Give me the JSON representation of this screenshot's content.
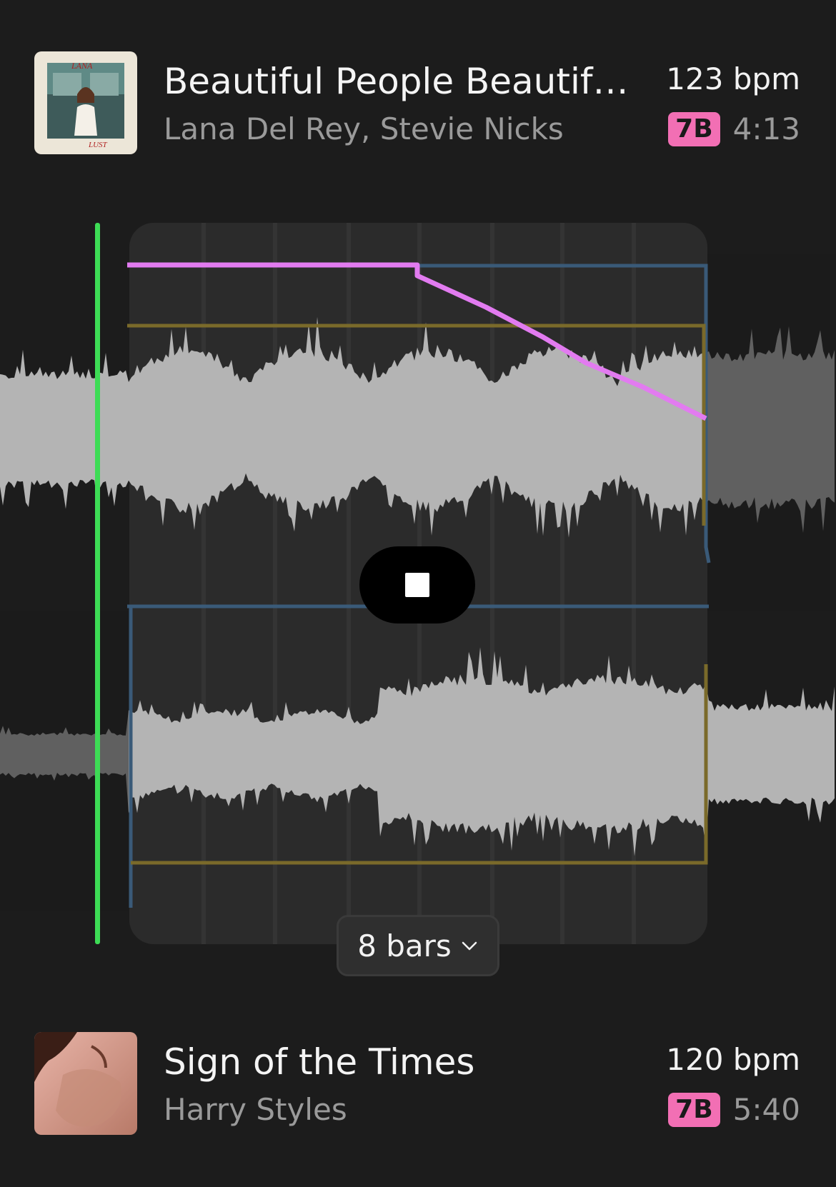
{
  "current_track": {
    "title": "Beautiful People Beautiful...",
    "artist": "Lana Del Rey, Stevie Nicks",
    "bpm": "123 bpm",
    "key": "7B",
    "duration": "4:13",
    "cover_icon": "album-cover-lust-for-life"
  },
  "next_track": {
    "title": "Sign of the Times",
    "artist": "Harry Styles",
    "bpm": "120 bpm",
    "key": "7B",
    "duration": "5:40",
    "cover_icon": "album-cover-harry-styles"
  },
  "transition": {
    "bars_label": "8 bars",
    "stop_icon": "stop-icon",
    "playhead_color": "#3ddc55",
    "automation_color": "#e27bf0",
    "eq_blue_color": "#3a5a78",
    "eq_yellow_color": "#7a6a2a"
  },
  "colors": {
    "key_badge": "#f26fb4",
    "background": "#1c1c1c"
  }
}
